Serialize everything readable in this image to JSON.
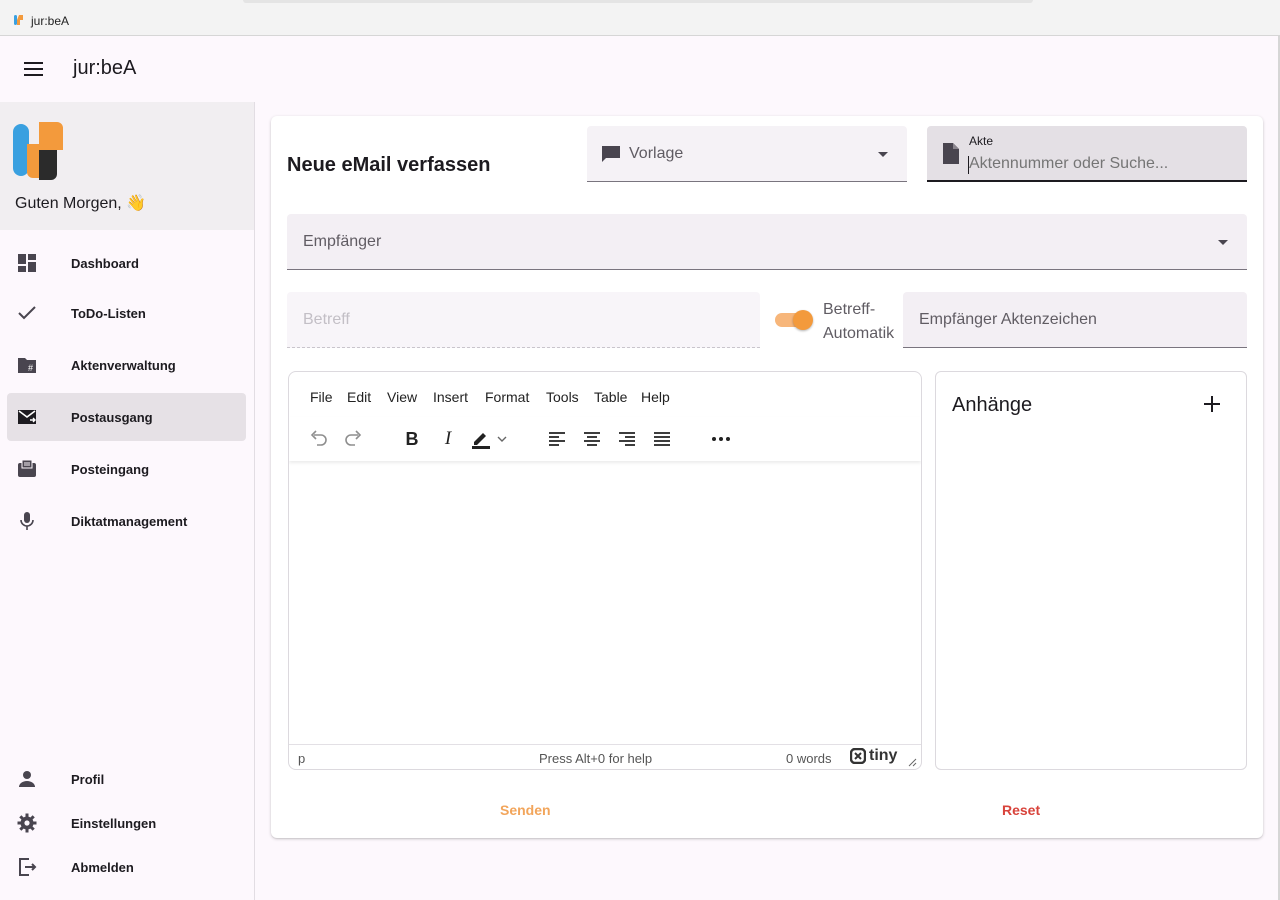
{
  "window": {
    "title": "jur:beA"
  },
  "appbar": {
    "title": "jur:beA"
  },
  "sidebar": {
    "greeting": "Guten Morgen, 👋",
    "nav": [
      {
        "label": "Dashboard",
        "icon": "dashboard-icon"
      },
      {
        "label": "ToDo-Listen",
        "icon": "check-icon"
      },
      {
        "label": "Aktenverwaltung",
        "icon": "folder-hash-icon"
      },
      {
        "label": "Postausgang",
        "icon": "outbox-icon",
        "active": true
      },
      {
        "label": "Posteingang",
        "icon": "inbox-icon"
      },
      {
        "label": "Diktatmanagement",
        "icon": "microphone-icon"
      }
    ],
    "bottom_nav": [
      {
        "label": "Profil",
        "icon": "person-icon"
      },
      {
        "label": "Einstellungen",
        "icon": "gear-icon"
      },
      {
        "label": "Abmelden",
        "icon": "logout-icon"
      }
    ]
  },
  "form": {
    "title": "Neue eMail verfassen",
    "vorlage_placeholder": "Vorlage",
    "akte_label": "Akte",
    "akte_placeholder": "Aktennummer oder Suche...",
    "empfaenger_placeholder": "Empfänger",
    "betreff_placeholder": "Betreff",
    "betreff_auto_label": "Betreff-Automatik",
    "betreff_auto_on": true,
    "aktenzeichen_placeholder": "Empfänger Aktenzeichen",
    "send_label": "Senden",
    "reset_label": "Reset"
  },
  "editor": {
    "menu": [
      "File",
      "Edit",
      "View",
      "Insert",
      "Format",
      "Tools",
      "Table",
      "Help"
    ],
    "status_path": "p",
    "status_help": "Press Alt+0 for help",
    "status_words": "0 words",
    "brand": "tiny"
  },
  "attachments": {
    "title": "Anhänge"
  },
  "colors": {
    "accent": "#f39a3c",
    "send": "#f2a55b",
    "reset": "#d8433b",
    "logo_blue": "#3aa0e0",
    "logo_orange": "#f39a3c"
  }
}
